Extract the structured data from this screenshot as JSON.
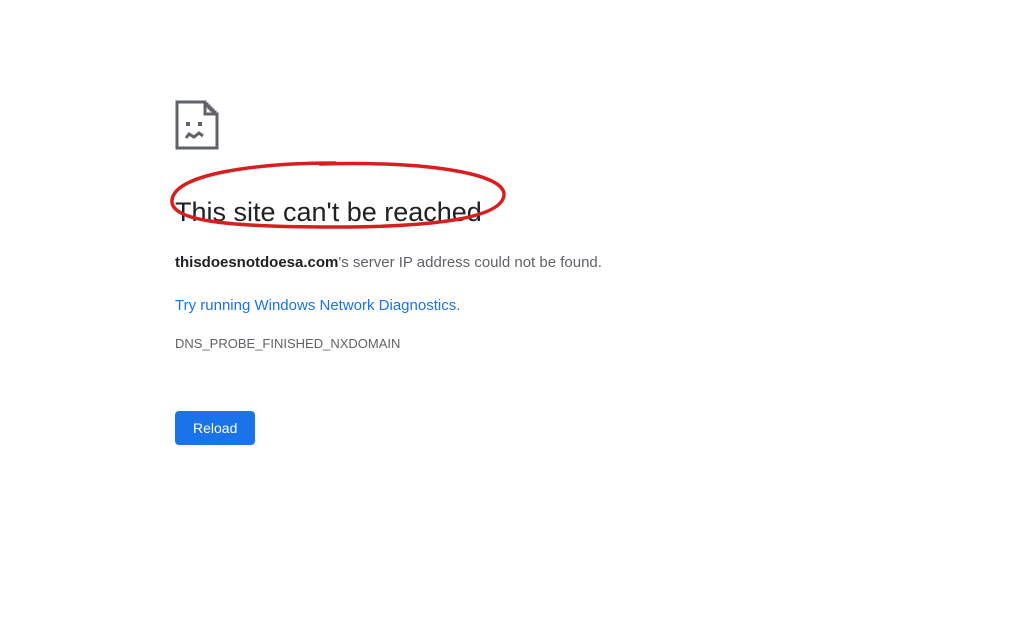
{
  "error": {
    "heading": "This site can't be reached",
    "domain": "thisdoesnotdoesa.com",
    "message_suffix": "'s server IP address could not be found.",
    "diagnostics_link": "Try running Windows Network Diagnostics",
    "diagnostics_period": ".",
    "error_code": "DNS_PROBE_FINISHED_NXDOMAIN",
    "reload_button": "Reload"
  },
  "annotation": {
    "stroke_color": "#d81e1e"
  }
}
